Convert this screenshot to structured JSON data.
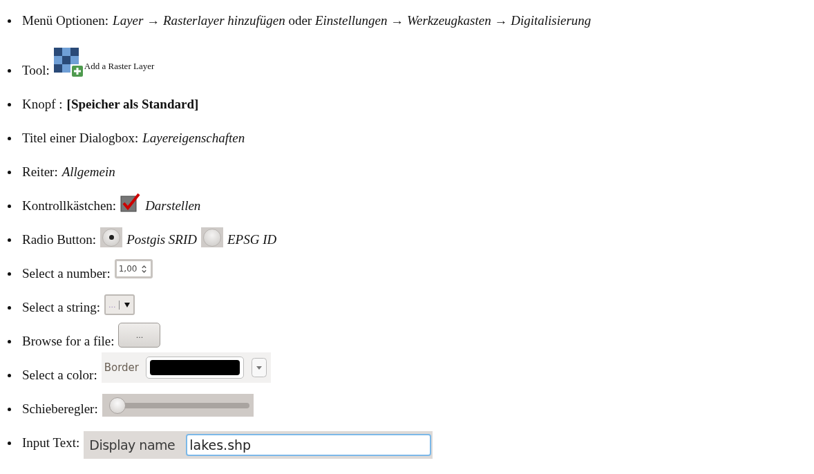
{
  "items": [
    {
      "kind": "menu",
      "label": "Menü Optionen:",
      "text": "*Layer* → *Rasterlayer hinzufügen* oder *Einstellungen* → *Werkzeugkasten* → *Digitalisierung*"
    },
    {
      "kind": "tool",
      "label": "Tool:",
      "caption": "Add a Raster Layer"
    },
    {
      "kind": "button",
      "label": "Knopf :",
      "text": "[Speicher als Standard]"
    },
    {
      "kind": "dialog",
      "label": "Titel einer Dialogbox:",
      "text": "Layereigenschaften"
    },
    {
      "kind": "tab",
      "label": "Reiter:",
      "text": "Allgemein"
    },
    {
      "kind": "checkbox",
      "label": "Kontrollkästchen:",
      "checked": true,
      "text": "Darstellen"
    },
    {
      "kind": "radio",
      "label": "Radio Button:",
      "options": [
        {
          "text": "Postgis SRID",
          "selected": true
        },
        {
          "text": "EPSG ID",
          "selected": false
        }
      ]
    },
    {
      "kind": "spinbox",
      "label": "Select a number:",
      "value": "1,00"
    },
    {
      "kind": "combo",
      "label": "Select a string:",
      "value": "..."
    },
    {
      "kind": "browse",
      "label": "Browse for a file:",
      "value": "..."
    },
    {
      "kind": "color",
      "label": "Select a color:",
      "caption": "Border",
      "color": "#000000"
    },
    {
      "kind": "slider",
      "label": "Schieberegler:",
      "level": 0
    },
    {
      "kind": "input",
      "label": "Input Text:",
      "caption": "Display name",
      "value": "lakes.shp"
    }
  ]
}
